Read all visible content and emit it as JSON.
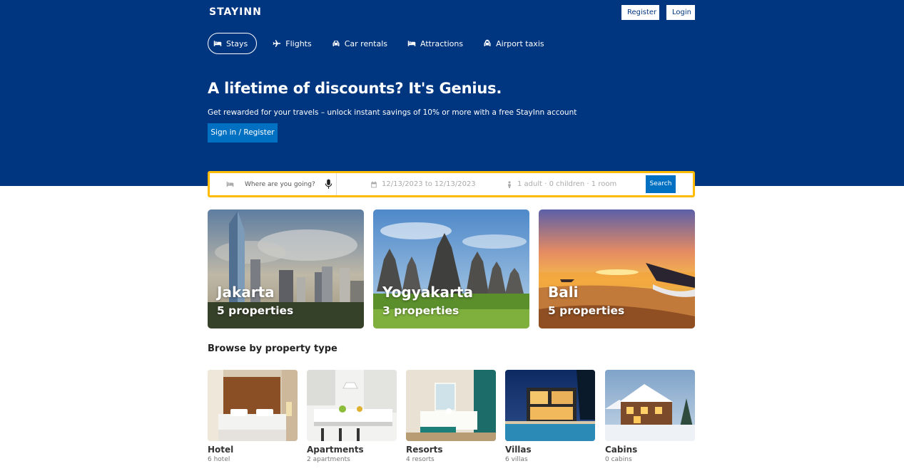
{
  "brand": {
    "logo": "STAYINN",
    "register_label": "Register",
    "login_label": "Login"
  },
  "nav": [
    {
      "label": "Stays",
      "icon": "bed-icon",
      "active": true
    },
    {
      "label": "Flights",
      "icon": "plane-icon",
      "active": false
    },
    {
      "label": "Car rentals",
      "icon": "car-icon",
      "active": false
    },
    {
      "label": "Attractions",
      "icon": "bed-icon",
      "active": false
    },
    {
      "label": "Airport taxis",
      "icon": "taxi-icon",
      "active": false
    }
  ],
  "hero": {
    "headline": "A lifetime of discounts? It's Genius.",
    "subline": "Get rewarded for your travels – unlock instant savings of 10% or more with a free StayInn account",
    "signin_label": "Sign in / Register"
  },
  "search": {
    "destination_placeholder": "Where are you going?",
    "dates": "12/13/2023 to 12/13/2023",
    "guests": "1 adult · 0 children · 1 room",
    "button_label": "Search"
  },
  "featured": [
    {
      "city": "Jakarta",
      "count": "5 properties"
    },
    {
      "city": "Yogyakarta",
      "count": "3 properties"
    },
    {
      "city": "Bali",
      "count": "5 properties"
    }
  ],
  "browse": {
    "title": "Browse by property type",
    "types": [
      {
        "name": "Hotel",
        "count": "6 hotel"
      },
      {
        "name": "Apartments",
        "count": "2 apartments"
      },
      {
        "name": "Resorts",
        "count": "4 resorts"
      },
      {
        "name": "Villas",
        "count": "6 villas"
      },
      {
        "name": "Cabins",
        "count": "0 cabins"
      }
    ]
  },
  "colors": {
    "brand_blue": "#003580",
    "accent_blue": "#0071c2",
    "search_border": "#febb02"
  }
}
